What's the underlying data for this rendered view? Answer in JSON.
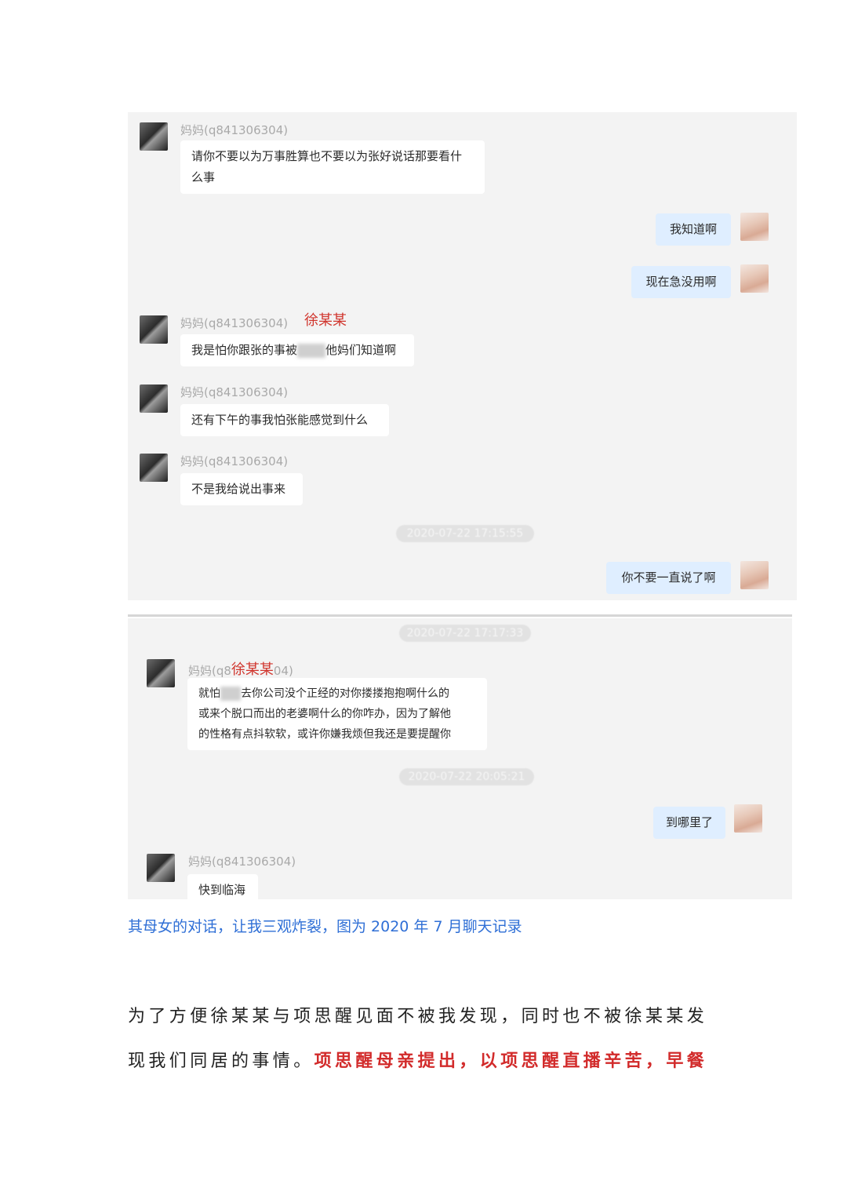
{
  "chat1": {
    "m1": {
      "sender": "妈妈(q841306304)",
      "line1": "请你不要以为万事胜算也不要以为张好说话那要看什",
      "line2": "么事"
    },
    "r1": "我知道啊",
    "r2": "现在急没用啊",
    "m2": {
      "sender": "妈妈(q841306304)",
      "annotation": "徐某某",
      "pre": "我是怕你跟张的事被",
      "post": "他妈们知道啊"
    },
    "m3": {
      "sender": "妈妈(q841306304)",
      "text": "还有下午的事我怕张能感觉到什么"
    },
    "m4": {
      "sender": "妈妈(q841306304)",
      "text": "不是我给说出事来"
    },
    "timestamp": "2020-07-22 17:15:55",
    "r3": "你不要一直说了啊"
  },
  "chat2": {
    "timestamp1": "2020-07-22 17:17:33",
    "m1": {
      "sender_prefix": "妈妈(q8",
      "annotation": "徐某某",
      "sender_suffix": "04)",
      "line1_pre": "就怕",
      "line1_post": "去你公司没个正经的对你搂搂抱抱啊什么的",
      "line2": "或来个脱口而出的老婆啊什么的你咋办，因为了解他",
      "line3": "的性格有点抖软软，或许你嫌我烦但我还是要提醒你"
    },
    "timestamp2": "2020-07-22 20:05:21",
    "r1": "到哪里了",
    "m2": {
      "sender": "妈妈(q841306304)",
      "text": "快到临海"
    }
  },
  "caption": "其母女的对话，让我三观炸裂，图为 2020 年 7 月聊天记录",
  "paragraph": {
    "line1": "为了方便徐某某与项思醒见面不被我发现，同时也不被徐某某发",
    "line2_plain": "现我们同居的事情。",
    "line2_highlight": "项思醒母亲提出，以项思醒直播辛苦，早餐"
  },
  "colors": {
    "accent_blue": "#2f6fd6",
    "highlight_red": "#d22b2b",
    "annotation_red": "#d0342c"
  }
}
